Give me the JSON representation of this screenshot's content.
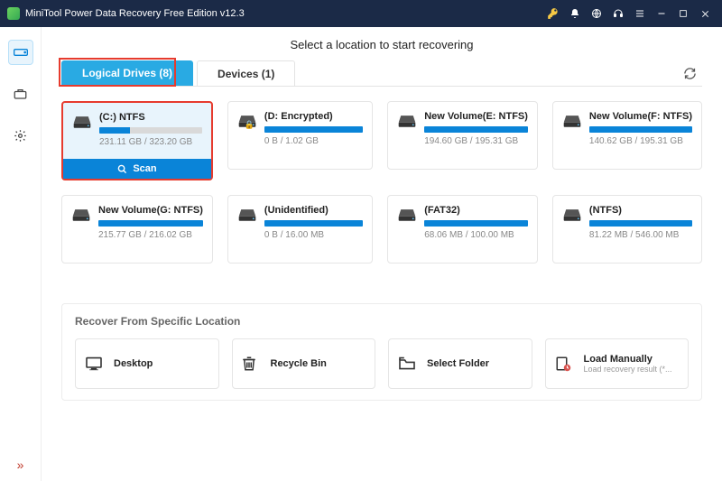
{
  "app": {
    "title": "MiniTool Power Data Recovery Free Edition v12.3"
  },
  "header": {
    "heading": "Select a location to start recovering"
  },
  "tabs": {
    "logical": "Logical Drives (8)",
    "devices": "Devices (1)"
  },
  "scan_label": "Scan",
  "drives": [
    {
      "name": "(C:) NTFS",
      "size": "231.11 GB / 323.20 GB",
      "fill": 30,
      "selected": true
    },
    {
      "name": "(D: Encrypted)",
      "size": "0 B / 1.02 GB",
      "fill": 100,
      "locked": true
    },
    {
      "name": "New Volume(E: NTFS)",
      "size": "194.60 GB / 195.31 GB",
      "fill": 100
    },
    {
      "name": "New Volume(F: NTFS)",
      "size": "140.62 GB / 195.31 GB",
      "fill": 100
    },
    {
      "name": "New Volume(G: NTFS)",
      "size": "215.77 GB / 216.02 GB",
      "fill": 100
    },
    {
      "name": "(Unidentified)",
      "size": "0 B / 16.00 MB",
      "fill": 100
    },
    {
      "name": "(FAT32)",
      "size": "68.06 MB / 100.00 MB",
      "fill": 100
    },
    {
      "name": "(NTFS)",
      "size": "81.22 MB / 546.00 MB",
      "fill": 100
    }
  ],
  "recover_section": {
    "title": "Recover From Specific Location",
    "items": [
      {
        "name": "Desktop"
      },
      {
        "name": "Recycle Bin"
      },
      {
        "name": "Select Folder"
      },
      {
        "name": "Load Manually",
        "sub": "Load recovery result (*..."
      }
    ]
  }
}
